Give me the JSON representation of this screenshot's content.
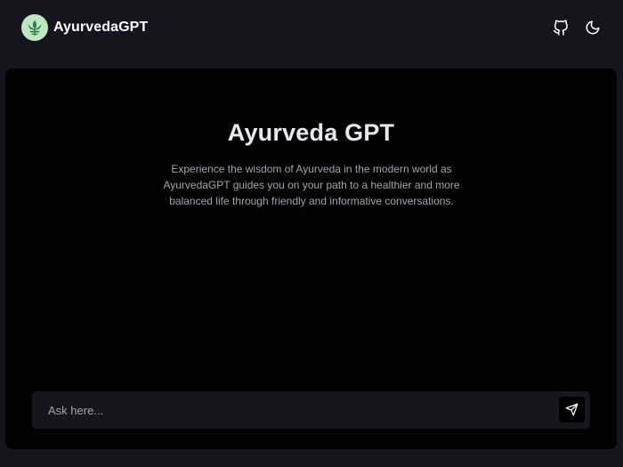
{
  "header": {
    "brand_name": "AyurvedaGPT",
    "logo_icon": "leaf-icon",
    "actions": [
      {
        "icon": "github-icon"
      },
      {
        "icon": "moon-icon"
      }
    ]
  },
  "hero": {
    "title": "Ayurveda GPT",
    "description": "Experience the wisdom of Ayurveda in the modern world as AyurvedaGPT guides you on your path to a healthier and more balanced life through friendly and informative conversations."
  },
  "composer": {
    "placeholder": "Ask here...",
    "value": "",
    "send_icon": "send-icon"
  },
  "colors": {
    "background": "#16151f",
    "panel": "#020203",
    "composer": "#17161f",
    "logo_bg": "#bfe6c3",
    "logo_fg": "#2e7d4f",
    "text_primary": "#ffffff",
    "text_secondary": "#a3a3ad"
  }
}
